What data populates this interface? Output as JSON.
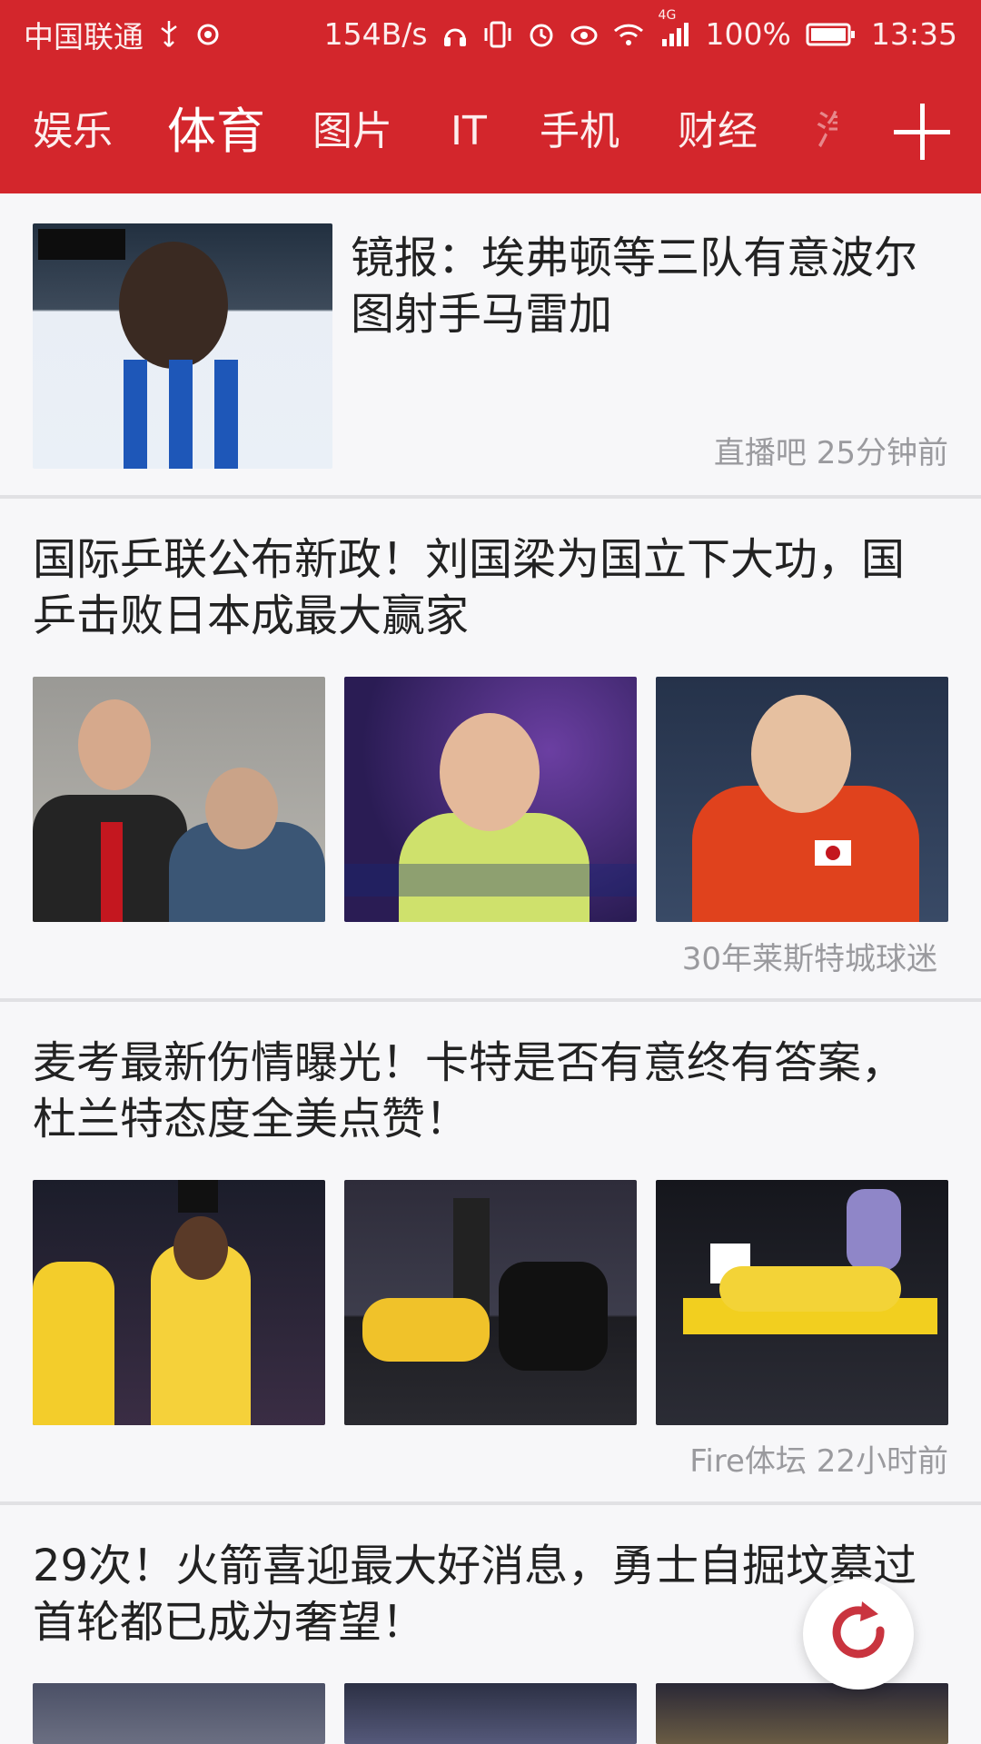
{
  "status_bar": {
    "carrier": "中国联通",
    "net_speed": "154B/s",
    "network_type": "4G",
    "battery": "100%",
    "time": "13:35",
    "icons": [
      "usb-icon",
      "sync-icon",
      "headset-icon",
      "vibrate-icon",
      "alarm-icon",
      "eye-icon",
      "wifi-icon",
      "signal-icon",
      "battery-icon"
    ]
  },
  "tabs": [
    {
      "label": "娱乐",
      "active": false
    },
    {
      "label": "体育",
      "active": true
    },
    {
      "label": "图片",
      "active": false
    },
    {
      "label": "IT",
      "active": false
    },
    {
      "label": "手机",
      "active": false
    },
    {
      "label": "财经",
      "active": false
    },
    {
      "label": "汽",
      "active": false
    }
  ],
  "add_tab": {
    "icon": "plus-icon"
  },
  "feed": [
    {
      "title": "镜报：埃弗顿等三队有意波尔图射手马雷加",
      "source": "直播吧",
      "time": "25分钟前"
    },
    {
      "title": "国际乒联公布新政！刘国梁为国立下大功，国乒击败日本成最大赢家",
      "source": "30年莱斯特城球迷",
      "time": ""
    },
    {
      "title": "麦考最新伤情曝光！卡特是否有意终有答案，杜兰特态度全美点赞！",
      "source": "Fire体坛",
      "time": "22小时前"
    },
    {
      "title": "29次！火箭喜迎最大好消息，勇士自掘坟墓过首轮都已成为奢望！",
      "source": "",
      "time": ""
    }
  ],
  "fab": {
    "icon": "refresh-icon"
  },
  "colors": {
    "brand_red": "#d3262c",
    "meta_gray": "#9a9a9e",
    "fab_red": "#c9343f"
  }
}
